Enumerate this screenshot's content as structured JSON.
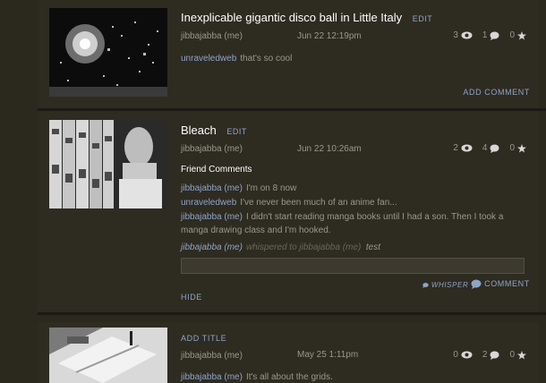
{
  "posts": [
    {
      "title": "Inexplicable gigantic disco ball in Little Italy",
      "edit": "EDIT",
      "author": "jibbajabba (me)",
      "date": "Jun 22 12:19pm",
      "views": "3",
      "comments": "1",
      "favorites": "0",
      "comment_list": [
        {
          "who": "unraveledweb",
          "text": "that's so cool"
        }
      ],
      "add_comment": "ADD COMMENT"
    },
    {
      "title": "Bleach",
      "edit": "EDIT",
      "author": "jibbajabba (me)",
      "date": "Jun 22 10:26am",
      "views": "2",
      "comments": "4",
      "favorites": "0",
      "friend_heading": "Friend Comments",
      "comment_list": [
        {
          "who": "jibbajabba (me)",
          "text": "I'm on 8 now"
        },
        {
          "who": "unraveledweb",
          "text": "I've never been much of an anime fan..."
        },
        {
          "who": "jibbajabba (me)",
          "text": "I didn't start reading manga books until I had a son. Then I took a manga drawing class and I'm hooked."
        }
      ],
      "whisper": {
        "who": "jibbajabba (me)",
        "mid": "whispered to jibbajabba (me)",
        "text": "test"
      },
      "whisper_btn": "WHISPER",
      "comment_btn": "COMMENT",
      "hide": "HIDE"
    },
    {
      "add_title": "ADD TITLE",
      "author": "jibbajabba (me)",
      "date": "May 25 1:11pm",
      "views": "0",
      "comments": "2",
      "favorites": "0",
      "comment_list": [
        {
          "who": "jibbajabba (me)",
          "text": "It's all about the grids."
        }
      ]
    }
  ],
  "colors": {
    "link": "#8fa4c8",
    "background": "#2b281e",
    "panel": "#2e2b21"
  },
  "icons": [
    "eye-icon",
    "speech-bubble-icon",
    "star-icon"
  ]
}
